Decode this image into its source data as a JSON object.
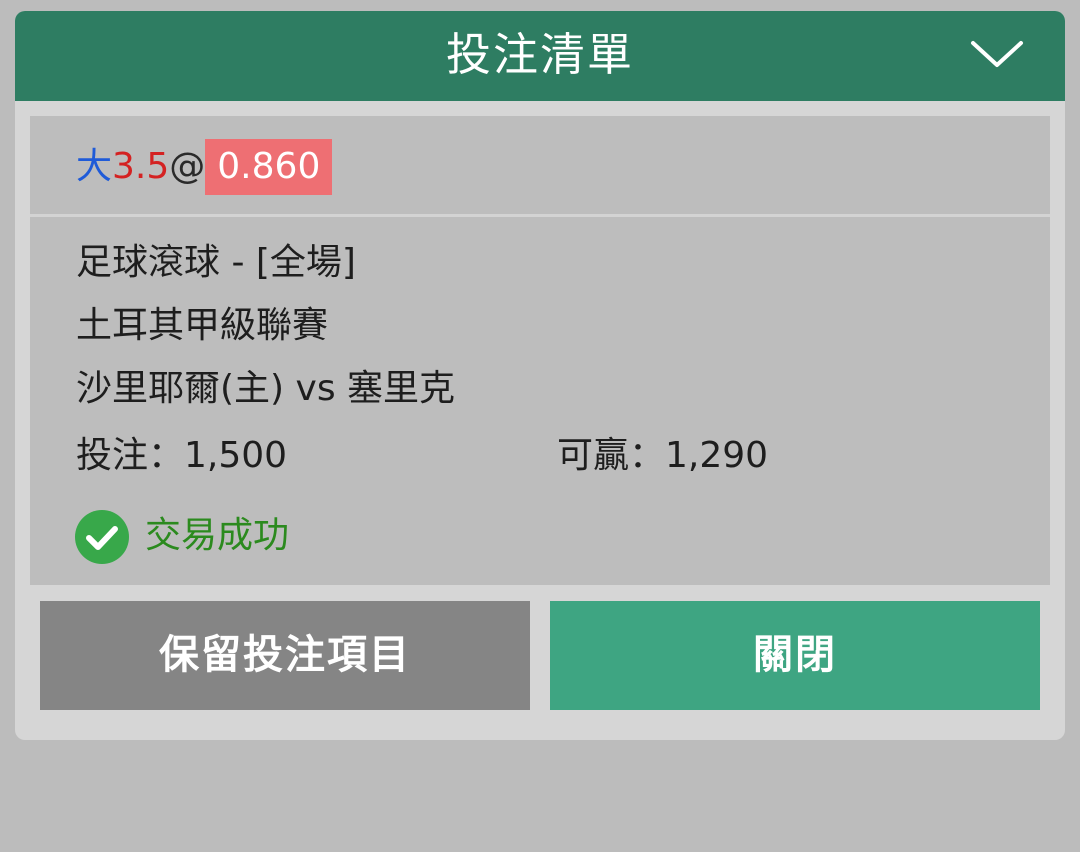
{
  "header": {
    "title": "投注清單",
    "collapse_icon": "chevron-down-icon"
  },
  "bet": {
    "selection": "大",
    "line": "3.5",
    "at": "@",
    "odds": "0.860",
    "market": "足球滾球 - [全場]",
    "league": "土耳其甲級聯賽",
    "match": "沙里耶爾(主) vs 塞里克",
    "stake_label": "投注：1,500",
    "payout_label": "可贏：1,290",
    "status_icon": "check-circle-icon",
    "status": "交易成功"
  },
  "buttons": {
    "keep_label": "保留投注項目",
    "close_label": "關閉"
  },
  "colors": {
    "header_bg": "#2e7d62",
    "selection": "#1f5bd8",
    "line": "#d42222",
    "odds_bg": "#ee6f73",
    "success": "#2b8a1e",
    "keep_button": "#858585",
    "close_button": "#3ea582"
  }
}
